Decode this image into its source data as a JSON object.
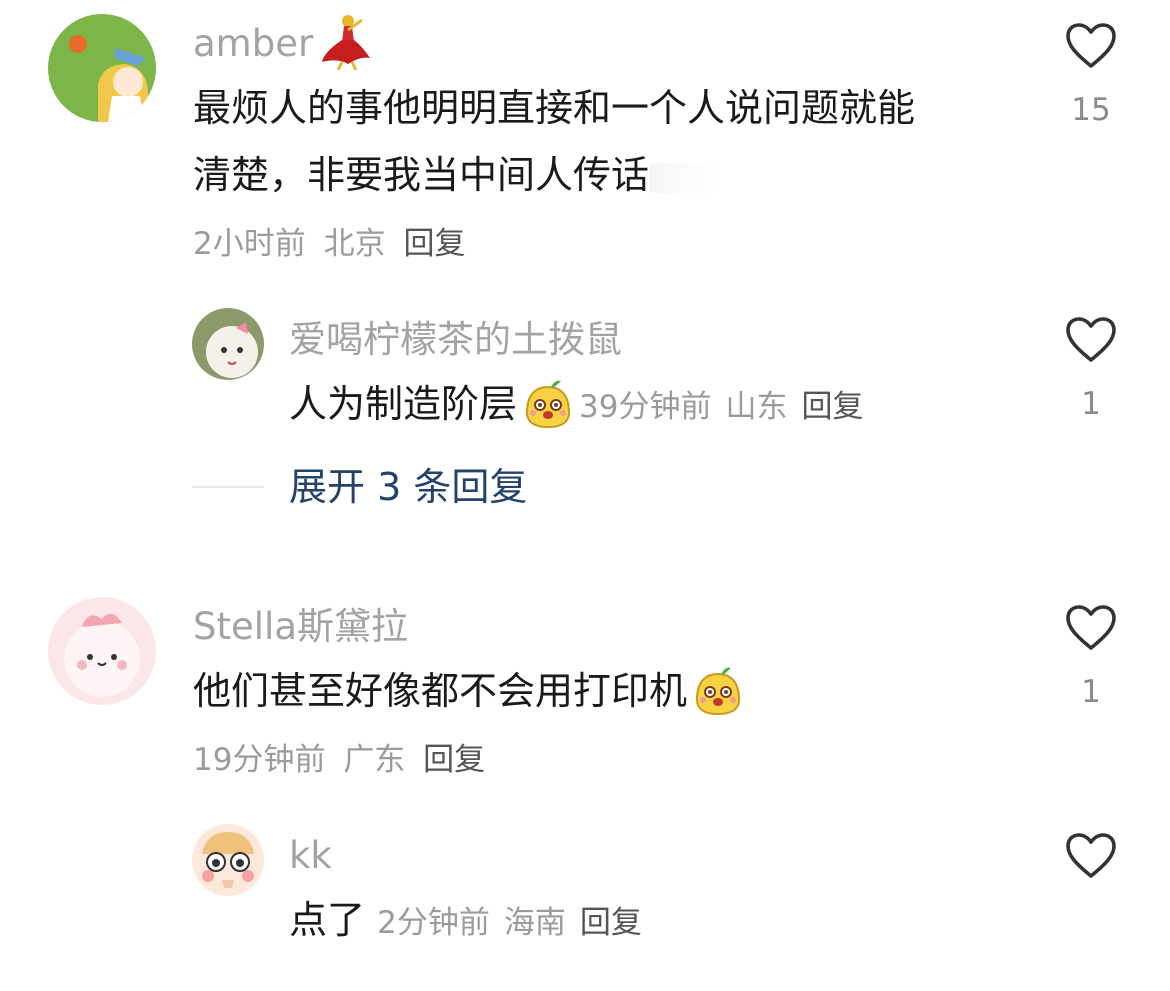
{
  "comments": [
    {
      "username": "amber",
      "text_line1": "最烦人的事他明明直接和一个人说问题就能",
      "text_line2": "清楚，非要我当中间人传话",
      "time": "2小时前",
      "location": "北京",
      "reply_label": "回复",
      "likes": "15",
      "replies": [
        {
          "username": "爱喝柠檬茶的土拨鼠",
          "text": "人为制造阶层",
          "time": "39分钟前",
          "location": "山东",
          "reply_label": "回复",
          "likes": "1"
        }
      ],
      "expand_label": "展开 3 条回复"
    },
    {
      "username": "Stella斯黛拉",
      "text": "他们甚至好像都不会用打印机",
      "time": "19分钟前",
      "location": "广东",
      "reply_label": "回复",
      "likes": "1",
      "replies": [
        {
          "username": "kk",
          "text": "点了",
          "time": "2分钟前",
          "location": "海南",
          "reply_label": "回复",
          "likes": ""
        }
      ]
    }
  ],
  "icons": {
    "like": "heart-outline-icon",
    "emoji": "smiling-bean-emoji",
    "name_badge": "flamenco-dancer-emoji"
  },
  "colors": {
    "username": "#a3a3a3",
    "body_text": "#1a1a1a",
    "meta": "#9b9b9b",
    "reply": "#555555",
    "expand_link": "#23436b",
    "heart_stroke": "#333333"
  }
}
